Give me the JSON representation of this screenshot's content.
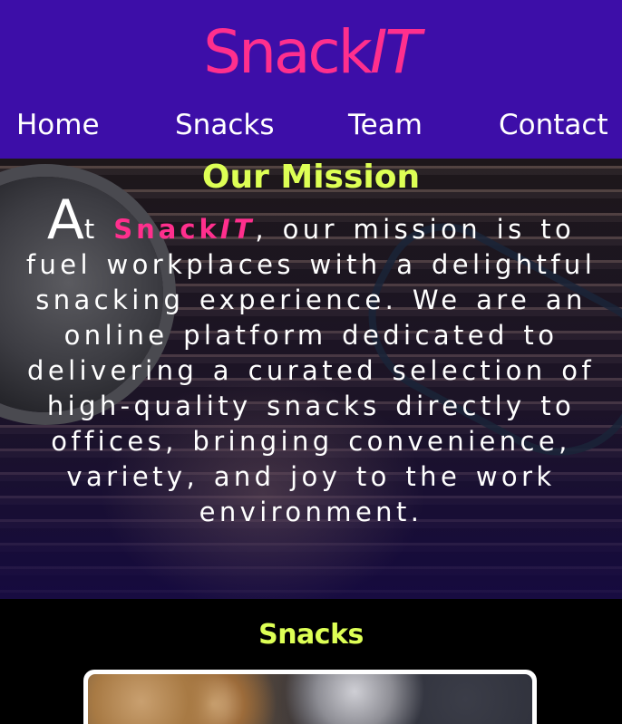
{
  "header": {
    "logo": {
      "main": "Snack",
      "accent": "IT"
    },
    "nav": [
      {
        "label": "Home"
      },
      {
        "label": "Snacks"
      },
      {
        "label": "Team"
      },
      {
        "label": "Contact"
      }
    ]
  },
  "mission": {
    "title": "Our Mission",
    "dropcap": "A",
    "lead": "t ",
    "brand_main": "Snack",
    "brand_accent": "IT",
    "body": ", our mission is to fuel workplaces with a delightful snacking experience. We are an online platform dedicated to delivering a curated selection of high-quality snacks directly to offices, bringing convenience, variety, and joy to the work environment."
  },
  "snacks": {
    "title": "Snacks"
  },
  "colors": {
    "header_bg": "#3d0ea8",
    "brand_pink": "#ff2f8d",
    "heading_lime": "#ddff55",
    "text_white": "#ffffff"
  }
}
